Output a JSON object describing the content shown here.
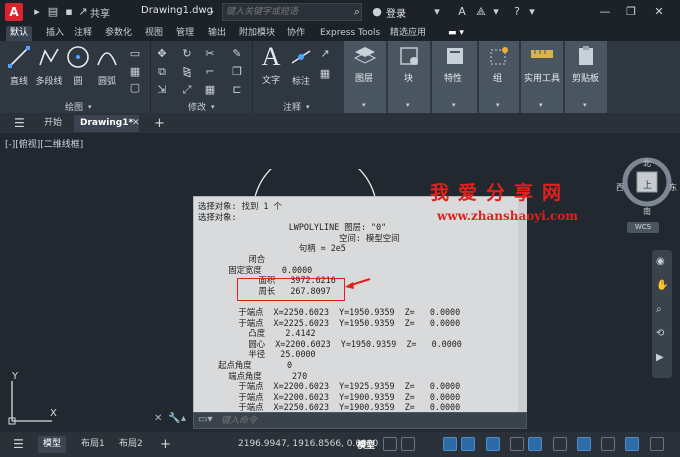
{
  "titlebar": {
    "share_label": "共享",
    "doc_title": "Drawing1.dwg",
    "search_placeholder": "键入关键字或短语",
    "login_label": "登录"
  },
  "ribbon_tabs": [
    "默认",
    "插入",
    "注释",
    "参数化",
    "视图",
    "管理",
    "输出",
    "附加模块",
    "协作",
    "Express Tools",
    "精选应用"
  ],
  "ribbon": {
    "draw_buttons": [
      "直线",
      "多段线",
      "圆",
      "圆弧"
    ],
    "draw_panel_title": "绘图",
    "modify_panel_title": "修改",
    "annotation_buttons": [
      "文字",
      "标注"
    ],
    "annotation_panel_title": "注释",
    "layer_label": "图层",
    "block_label": "块",
    "properties_label": "特性",
    "group_label": "组",
    "utilities_label": "实用工具",
    "clipboard_label": "剪贴板"
  },
  "file_tabs": {
    "start_label": "开始",
    "drawing_label": "Drawing1*"
  },
  "canvas": {
    "view_label": "[-][俯视][二维线框]",
    "viewcube": {
      "north": "北",
      "south": "南",
      "west": "西",
      "east": "东",
      "top": "上",
      "wcs": "WCS"
    },
    "axis_y": "Y",
    "axis_x": "X"
  },
  "text_window": {
    "lines": [
      "选择对象: 找到 1 个",
      "选择对象:",
      "                  LWPOLYLINE 图层: \"0\"",
      "                            空间: 模型空间",
      "                    句柄 = 2e5",
      "          闭合",
      "      固定宽度    0.0000",
      "            面积   3972.6216",
      "            周长   267.8097",
      "",
      "        于端点  X=2250.6023  Y=1950.9359  Z=   0.0000",
      "        于端点  X=2225.6023  Y=1950.9359  Z=   0.0000",
      "          凸度    2.4142",
      "          圆心  X=2200.6023  Y=1950.9359  Z=   0.0000",
      "          半径   25.0000",
      "    起点角度       0",
      "      端点角度      270",
      "        于端点  X=2200.6023  Y=1925.9359  Z=   0.0000",
      "        于端点  X=2200.6023  Y=1900.9359  Z=   0.0000",
      "        于端点  X=2250.6023  Y=1900.9359  Z=   0.0000"
    ]
  },
  "watermark": {
    "title": "我爱分享网",
    "url": "www.zhanshaoyi.com"
  },
  "command_line": {
    "placeholder": "键入命令"
  },
  "statusbar": {
    "layout_tabs": [
      "模型",
      "布局1",
      "布局2"
    ],
    "coords": "2196.9947, 1916.8566, 0.0000",
    "model_label": "模型"
  },
  "colors": {
    "background": "#212830",
    "ribbon": "#2f3741",
    "highlight_box": "#e3201b",
    "text_window": "#d9dadb"
  }
}
